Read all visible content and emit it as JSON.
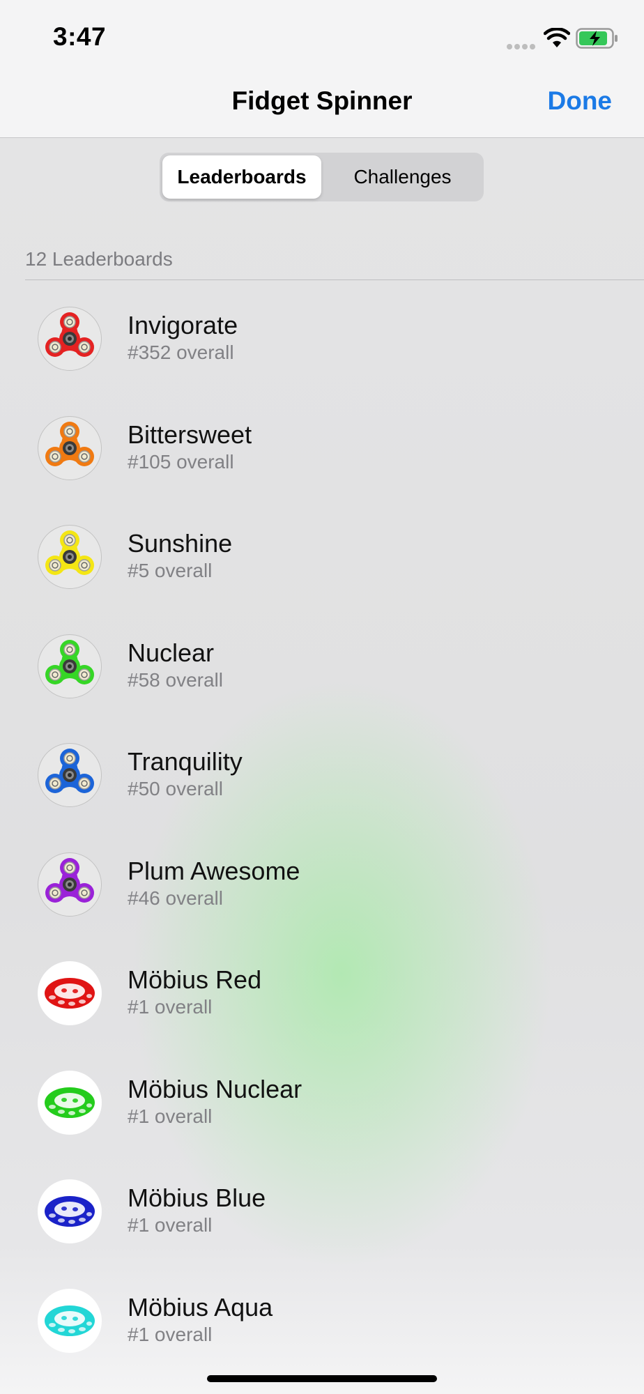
{
  "status_bar": {
    "time": "3:47"
  },
  "nav": {
    "title": "Fidget Spinner",
    "done_label": "Done"
  },
  "segments": [
    {
      "label": "Leaderboards",
      "selected": true
    },
    {
      "label": "Challenges",
      "selected": false
    }
  ],
  "section_header": "12 Leaderboards",
  "leaderboards": [
    {
      "name": "Invigorate",
      "rank": "#352 overall",
      "icon": "spinner-icon",
      "color": "#e42222"
    },
    {
      "name": "Bittersweet",
      "rank": "#105 overall",
      "icon": "spinner-icon",
      "color": "#f07a12"
    },
    {
      "name": "Sunshine",
      "rank": "#5 overall",
      "icon": "spinner-icon",
      "color": "#f4e614"
    },
    {
      "name": "Nuclear",
      "rank": "#58 overall",
      "icon": "spinner-icon",
      "color": "#36d626"
    },
    {
      "name": "Tranquility",
      "rank": "#50 overall",
      "icon": "spinner-icon",
      "color": "#1c64d8"
    },
    {
      "name": "Plum Awesome",
      "rank": "#46 overall",
      "icon": "spinner-icon",
      "color": "#9a22d8"
    },
    {
      "name": "Möbius Red",
      "rank": "#1 overall",
      "icon": "mobius-icon",
      "color": "#e01414"
    },
    {
      "name": "Möbius Nuclear",
      "rank": "#1 overall",
      "icon": "mobius-icon",
      "color": "#24cc1c"
    },
    {
      "name": "Möbius Blue",
      "rank": "#1 overall",
      "icon": "mobius-icon",
      "color": "#1a22c8"
    },
    {
      "name": "Möbius Aqua",
      "rank": "#1 overall",
      "icon": "mobius-icon",
      "color": "#22d6d6"
    }
  ],
  "colors": {
    "accent": "#1b7ae6",
    "battery_fill": "#35c759"
  }
}
